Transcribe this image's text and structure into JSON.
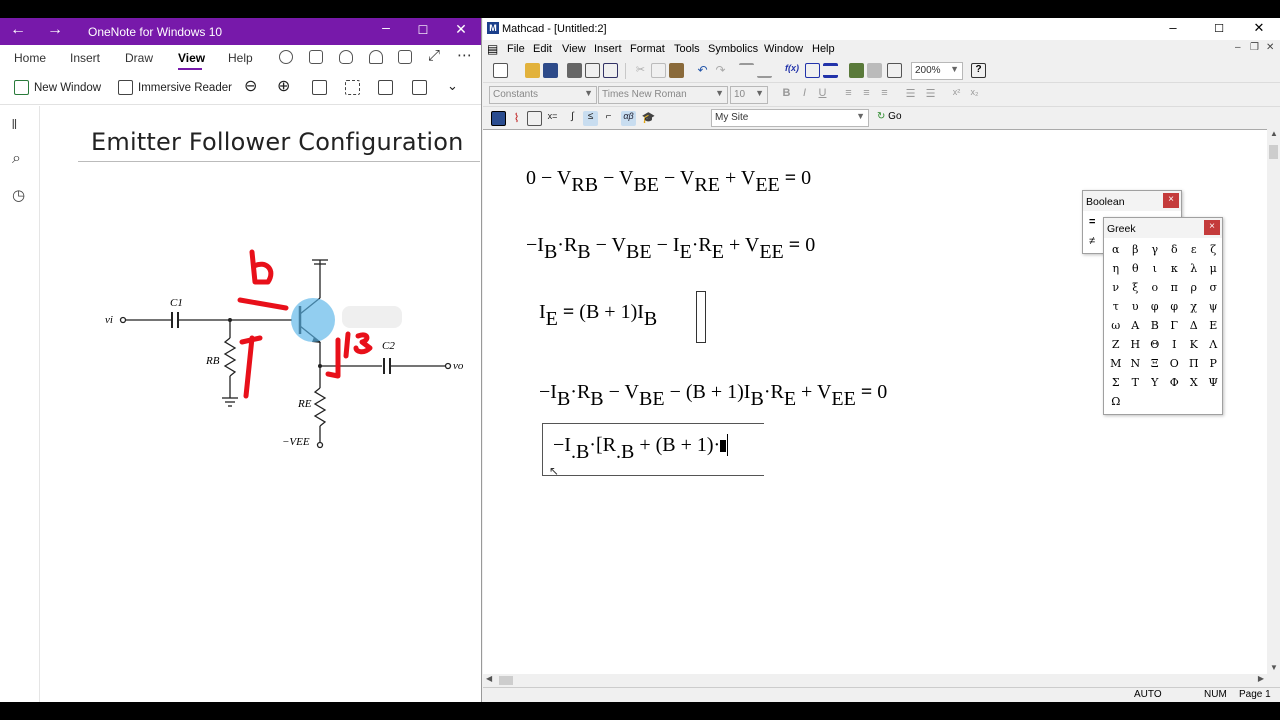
{
  "onenote": {
    "title": "OneNote for Windows 10",
    "tabs": [
      "Home",
      "Insert",
      "Draw",
      "View",
      "Help"
    ],
    "active_tab": "View",
    "ribbon": {
      "new_window": "New Window",
      "immersive_reader": "Immersive Reader"
    },
    "page_title": "Emitter Follower Configuration",
    "circuit_labels": {
      "c1": "C1",
      "c2": "C2",
      "rb": "RB",
      "re": "RE",
      "vi": "vi",
      "vo": "vo",
      "vee": "−VEE"
    }
  },
  "mathcad": {
    "title": "Mathcad - [Untitled:2]",
    "menu": [
      "File",
      "Edit",
      "View",
      "Insert",
      "Format",
      "Tools",
      "Symbolics",
      "Window",
      "Help"
    ],
    "zoom": "200%",
    "style_combo": "Constants",
    "font_combo": "Times New Roman",
    "size_combo": "10",
    "site_combo": "My Site",
    "go_label": "Go",
    "status": {
      "mode": "AUTO",
      "num": "NUM",
      "page": "Page 1"
    },
    "equations": {
      "eq1": {
        "a": "0 − V",
        "a_sub": "RB",
        "b": " − V",
        "b_sub": "BE",
        "c": " − V",
        "c_sub": "RE",
        "d": " + V",
        "d_sub": "EE",
        "op": " = ",
        "rhs": "0"
      },
      "eq2": {
        "a": "−I",
        "a_sub": "B",
        "b": "·R",
        "b_sub": "B",
        "c": " − V",
        "c_sub": "BE",
        "d": " − I",
        "d_sub": "E",
        "e": "·R",
        "e_sub": "E",
        "f": " + V",
        "f_sub": "EE",
        "op": " = ",
        "rhs": "0"
      },
      "eq3": {
        "a": "I",
        "a_sub": "E",
        "op": " = ",
        "b": "(B + 1)I",
        "b_sub": "B"
      },
      "eq4": {
        "a": "−I",
        "a_sub": "B",
        "b": "·R",
        "b_sub": "B",
        "c": " − V",
        "c_sub": "BE",
        "d": " − (B + 1)I",
        "d_sub": "B",
        "e": "·R",
        "e_sub": "E",
        "f": " + V",
        "f_sub": "EE",
        "op": " = ",
        "rhs": "0"
      },
      "eq5": {
        "a": "−I",
        "a_sub": ".B",
        "b": "·[R",
        "b_sub": ".B",
        "c": " + (B + 1)·"
      }
    },
    "boolean_palette": {
      "title": "Boolean",
      "items": [
        "=",
        "≠"
      ]
    },
    "greek_palette": {
      "title": "Greek",
      "letters": [
        "α",
        "β",
        "γ",
        "δ",
        "ε",
        "ζ",
        "η",
        "θ",
        "ι",
        "κ",
        "λ",
        "μ",
        "ν",
        "ξ",
        "ο",
        "π",
        "ρ",
        "σ",
        "τ",
        "υ",
        "φ",
        "φ",
        "χ",
        "ψ",
        "ω",
        "Α",
        "Β",
        "Γ",
        "Δ",
        "Ε",
        "Ζ",
        "Η",
        "Θ",
        "Ι",
        "Κ",
        "Λ",
        "Μ",
        "Ν",
        "Ξ",
        "Ο",
        "Π",
        "Ρ",
        "Σ",
        "Τ",
        "Υ",
        "Φ",
        "Χ",
        "Ψ",
        "Ω"
      ]
    },
    "close_glyph": "×"
  }
}
